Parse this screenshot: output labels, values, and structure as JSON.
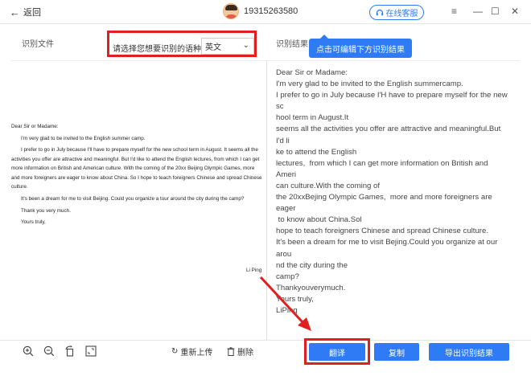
{
  "titlebar": {
    "back_label": "返回",
    "user_phone": "19315263580",
    "service_label": "在线客服"
  },
  "left_panel": {
    "title": "识别文件",
    "language_prompt": "请选择您想要识别的语种:",
    "language_value": "英文"
  },
  "right_panel": {
    "title": "识别结果",
    "tooltip": "点击可编辑下方识别结果"
  },
  "document": {
    "salutation": "Dear Sir or Madame:",
    "paragraphs": [
      "I'm very glad to be invited to the English summer camp.",
      "I prefer to go in July because I'll have to prepare myself for the new school term in August. It seems all the activities you offer are attractive and meaningful. But I'd like to attend the English lectures, from which I can get more information on British and American culture. With the coming of the 20xx Beijing Olympic Games, more and more foreigners are eager to know about China. So I hope to teach foreigners Chinese and spread Chinese culture.",
      "It's been a dream for me to visit Beijing. Could you organize a tour around the city during the camp?",
      "Thank you very much.",
      "Yours truly,"
    ],
    "signature": "Li Ping"
  },
  "ocr_result": "Dear Sir or Madame:\nI'm very glad to be invited to the English summercamp.\nI prefer to go in July because I'H have to prepare myself for the new sc\nhool term in August.It\nseems all the activities you offer are attractive and meaningful.But I'd li\nke to attend the English\nlectures,  from which I can get more information on British and Ameri\ncan culture.With the coming of\nthe 20xxBejing Olympic Games,  more and more foreigners are eager\n to know about China.Sol\nhope to teach foreigners Chinese and spread Chinese culture.\nIt's been a dream for me to visit Bejing.Could you organize at our arou\nnd the city during the\ncamp?\nThankyouverymuch.\nYours truly,\nLiPing",
  "toolbar": {
    "icons": [
      "zoom-in-icon",
      "zoom-out-icon",
      "rotate-icon",
      "fit-screen-icon"
    ],
    "reupload_label": "重新上传",
    "delete_label": "删除",
    "translate_label": "翻译",
    "copy_label": "复制",
    "export_label": "导出识别结果"
  },
  "colors": {
    "accent": "#2f7bf5",
    "highlight_red": "#e02020"
  }
}
